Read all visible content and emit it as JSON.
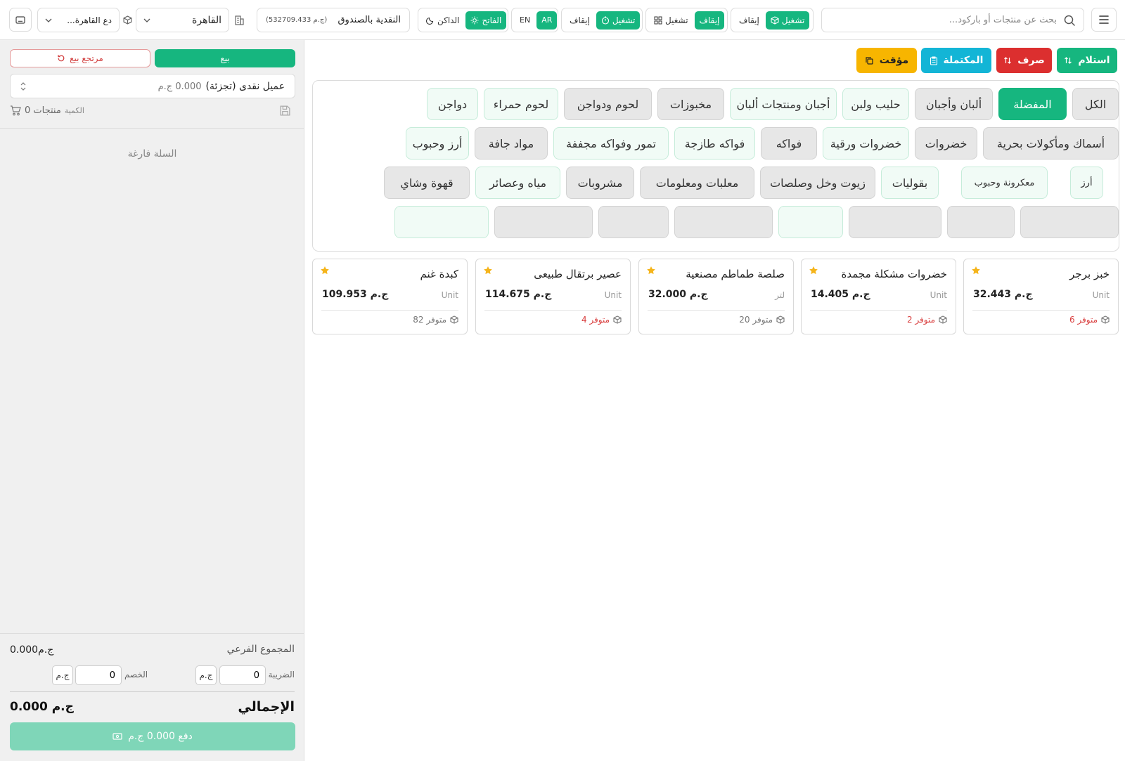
{
  "topbar": {
    "search_placeholder": "بحث عن منتجات أو باركود...",
    "toggle1_on": "تشغيل",
    "toggle1_off": "إيقاف",
    "toggle2_on": "تشغيل",
    "toggle2_off": "إيقاف",
    "toggle3_on": "تشغيل",
    "toggle3_off": "إيقاف",
    "lang_en": "EN",
    "lang_ar": "AR",
    "theme_light": "الفاتح",
    "theme_dark": "الداكن",
    "cash_label": "النقدية بالصندوق",
    "cash_value": "(532709.433 ج.م)",
    "city": "القاهرة",
    "warehouse": "...دع القاهرة"
  },
  "actions": {
    "receive": "استلام",
    "expense": "صرف",
    "completed": "المكتملة",
    "held": "مؤقت"
  },
  "categories": [
    "الكل",
    "المفضلة",
    "ألبان وأجبان",
    "حليب ولبن",
    "أجبان ومنتجات ألبان",
    "مخبوزات",
    "لحوم ودواجن",
    "لحوم حمراء",
    "دواجن",
    "أسماك ومأكولات بحرية",
    "خضروات",
    "خضروات ورقية",
    "فواكه",
    "فواكه طازجة",
    "تمور وفواكه مجففة",
    "مواد جافة",
    "أرز وحبوب",
    "أرز",
    "معكرونة وحبوب",
    "بقوليات",
    "زيوت وخل وصلصات",
    "معلبات ومعلومات",
    "مشروبات",
    "مياه وعصائر",
    "قهوة وشاي"
  ],
  "products": [
    {
      "name": "خبز برجر",
      "unit": "Unit",
      "price": "32.443 ج.م",
      "stock": "6 متوفر"
    },
    {
      "name": "خضروات مشكلة مجمدة",
      "unit": "Unit",
      "price": "14.405 ج.م",
      "stock": "2 متوفر"
    },
    {
      "name": "صلصة طماطم مصنعية",
      "unit": "لتر",
      "price": "32.000 ج.م",
      "stock": "20 متوفر"
    },
    {
      "name": "عصير برتقال طبيعى",
      "unit": "Unit",
      "price": "114.675 ج.م",
      "stock": "4 متوفر"
    },
    {
      "name": "كبدة غنم",
      "unit": "Unit",
      "price": "109.953 ج.م",
      "stock": "82 متوفر"
    }
  ],
  "cart": {
    "sale_tab": "بيع",
    "return_tab": "مرتجع بيع",
    "customer": "عميل نقدى (تجزئة)",
    "customer_balance": "0.000 ج.م",
    "count_label": "الكمية 0 منتجات",
    "count_text": "0 منتجات",
    "qty_label": "الكمية",
    "empty": "السلة فارغة",
    "subtotal_label": "المجموع الفرعي",
    "subtotal_value": "0.000ج.م",
    "tax_label": "الضريبة",
    "tax_value": "0",
    "discount_label": "الخصم",
    "discount_value": "0",
    "currency": "ج.م",
    "total_label": "الإجمالي",
    "total_value": "0.000 ج.م",
    "pay_button": "دفع 0.000 ج.م"
  },
  "colors": {
    "primary": "#16b67f",
    "danger": "#dc2f2f",
    "info": "#13b5d6",
    "warning": "#f7b500"
  }
}
